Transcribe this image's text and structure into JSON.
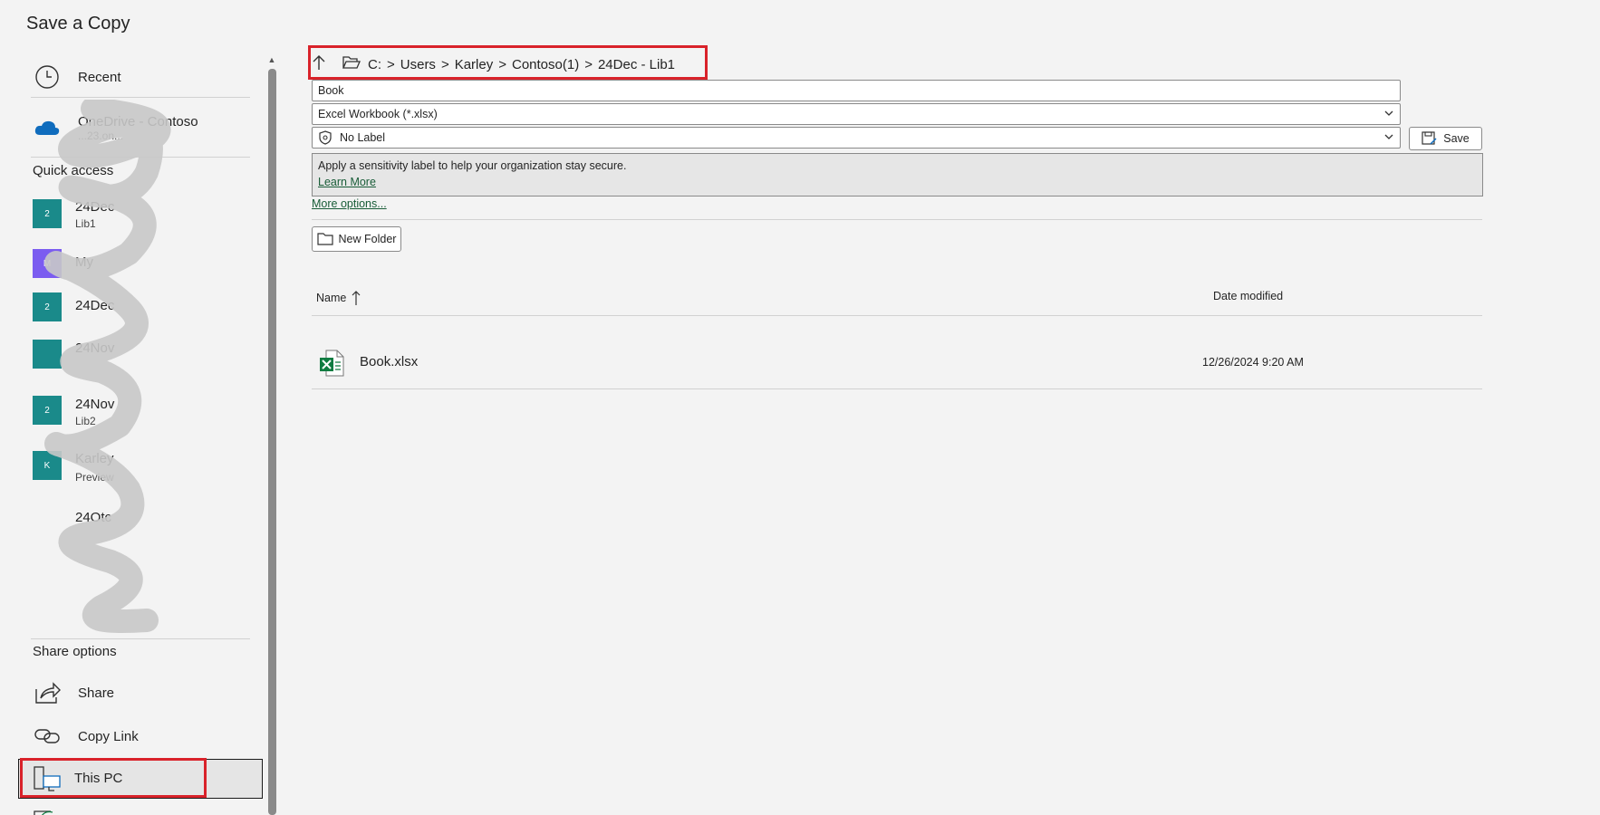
{
  "title": "Save a Copy",
  "left": {
    "recent": "Recent",
    "onedrive": {
      "label": "OneDrive - Contoso",
      "sub": "...23.on..."
    },
    "quick_access_label": "Quick access",
    "quick_items": [
      {
        "tile": "2",
        "label": "24Dec",
        "sub": "Lib1",
        "color": "#1a8a8a"
      },
      {
        "tile": "M",
        "label": "My",
        "sub": "",
        "color": "#7b5cf0"
      },
      {
        "tile": "2",
        "label": "24Dec",
        "sub": "",
        "color": "#1a8a8a"
      },
      {
        "tile": "",
        "label": "24Nov",
        "sub": "",
        "color": "#1a8a8a"
      },
      {
        "tile": "2",
        "label": "24Nov",
        "sub": "Lib2",
        "color": "#1a8a8a"
      },
      {
        "tile": "K",
        "label": "Karley",
        "sub": "Preview",
        "color": "#1a8a8a"
      },
      {
        "tile": "",
        "label": "24Otc",
        "sub": "",
        "color": ""
      }
    ],
    "share_options_label": "Share options",
    "share": "Share",
    "copy_link": "Copy Link",
    "this_pc": "This PC"
  },
  "breadcrumb": [
    "C:",
    "Users",
    "Karley",
    "Contoso(1)",
    "24Dec - Lib1"
  ],
  "filename_value": "Book",
  "filetype_value": "Excel Workbook (*.xlsx)",
  "label_value": "No Label",
  "save_label": "Save",
  "sensitivity": {
    "message": "Apply a sensitivity label to help your organization stay secure.",
    "learn_more": "Learn More"
  },
  "more_options": "More options...",
  "new_folder": "New Folder",
  "columns": {
    "name": "Name",
    "date": "Date modified"
  },
  "files": [
    {
      "name": "Book.xlsx",
      "date": "12/26/2024 9:20 AM"
    }
  ],
  "colors": {
    "accent_link": "#185c37",
    "highlight": "#d9222a",
    "excel_green": "#107c41"
  }
}
